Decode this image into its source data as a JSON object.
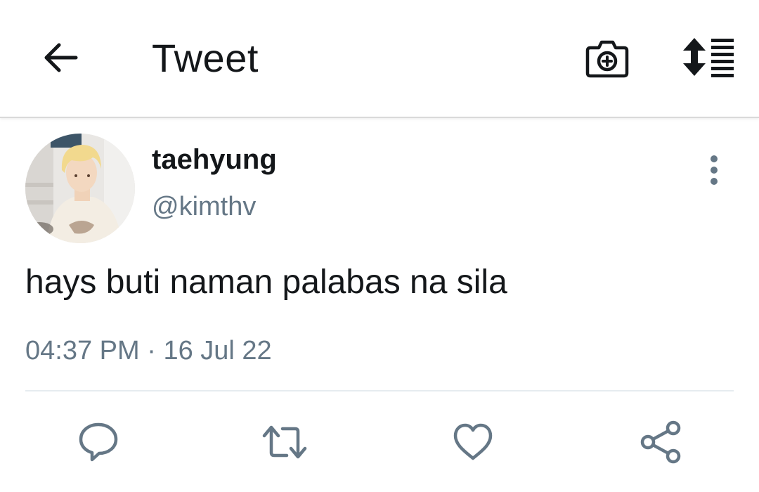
{
  "header": {
    "title": "Tweet",
    "back_icon": "arrow-left-icon",
    "camera_icon": "camera-add-icon",
    "sort_icon": "sort-list-icon"
  },
  "tweet": {
    "author": {
      "display_name": "taehyung",
      "handle": "@kimthv"
    },
    "text": "hays buti naman palabas na sila",
    "time": "04:37 PM",
    "separator": "·",
    "date": "16 Jul 22"
  },
  "actions": [
    {
      "name": "reply",
      "icon": "comment-icon"
    },
    {
      "name": "retweet",
      "icon": "retweet-icon"
    },
    {
      "name": "like",
      "icon": "heart-icon"
    },
    {
      "name": "share",
      "icon": "share-icon"
    }
  ],
  "colors": {
    "text_primary": "#14171a",
    "text_secondary": "#657786",
    "icon_gray": "#657786",
    "divider": "#e6ecf0"
  }
}
